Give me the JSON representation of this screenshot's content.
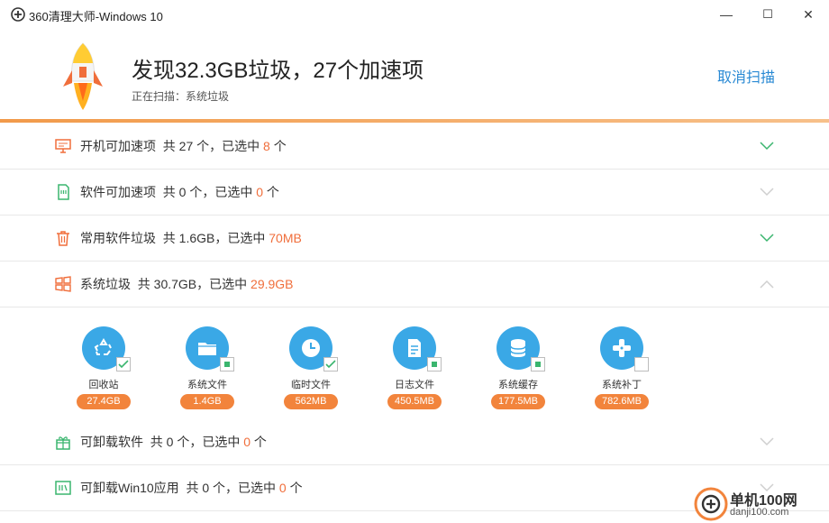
{
  "window": {
    "title": "360清理大师-Windows 10",
    "minimize_glyph": "—",
    "maximize_glyph": "☐",
    "close_glyph": "✕"
  },
  "header": {
    "headline": "发现32.3GB垃圾，27个加速项",
    "status": "正在扫描：系统垃圾",
    "cancel_label": "取消扫描"
  },
  "categories": [
    {
      "icon": "monitor-icon",
      "name": "开机可加速项",
      "pre": "  共 27 个，已选中 ",
      "selected": "8",
      "post": " 个",
      "expanded": false,
      "chevron_color": "#3ab56e"
    },
    {
      "icon": "sd-card-icon",
      "name": "软件可加速项",
      "pre": "  共 0 个，已选中 ",
      "selected": "0",
      "post": " 个",
      "expanded": false,
      "chevron_color": "#cfcfcf"
    },
    {
      "icon": "trash-icon",
      "name": "常用软件垃圾",
      "pre": "  共 1.6GB，已选中 ",
      "selected": "70MB",
      "post": "",
      "expanded": false,
      "chevron_color": "#3ab56e"
    },
    {
      "icon": "windows-icon",
      "name": "系统垃圾",
      "pre": "  共 30.7GB，已选中 ",
      "selected": "29.9GB",
      "post": "",
      "expanded": true,
      "chevron_color": "#cfcfcf"
    },
    {
      "icon": "gift-icon",
      "name": "可卸载软件",
      "pre": "  共 0 个，已选中 ",
      "selected": "0",
      "post": " 个",
      "expanded": false,
      "chevron_color": "#cfcfcf"
    },
    {
      "icon": "win10-app-icon",
      "name": "可卸载Win10应用",
      "pre": "  共 0 个，已选中 ",
      "selected": "0",
      "post": " 个",
      "expanded": false,
      "chevron_color": "#cfcfcf"
    }
  ],
  "system_items": [
    {
      "icon": "recycle-icon",
      "name": "回收站",
      "size": "27.4GB",
      "check": "checked"
    },
    {
      "icon": "folder-icon",
      "name": "系统文件",
      "size": "1.4GB",
      "check": "partial"
    },
    {
      "icon": "clock-icon",
      "name": "临时文件",
      "size": "562MB",
      "check": "checked"
    },
    {
      "icon": "document-icon",
      "name": "日志文件",
      "size": "450.5MB",
      "check": "partial"
    },
    {
      "icon": "database-icon",
      "name": "系统缓存",
      "size": "177.5MB",
      "check": "partial"
    },
    {
      "icon": "patch-icon",
      "name": "系统补丁",
      "size": "782.6MB",
      "check": "unchecked"
    }
  ],
  "watermark": {
    "line1": "单机100网",
    "line2": "danji100.com"
  },
  "colors": {
    "accent": "#f06e3b",
    "link": "#2a8ad4",
    "item_circle": "#3aa8e6",
    "size_badge": "#f2843c",
    "check_green": "#3ab56e"
  }
}
